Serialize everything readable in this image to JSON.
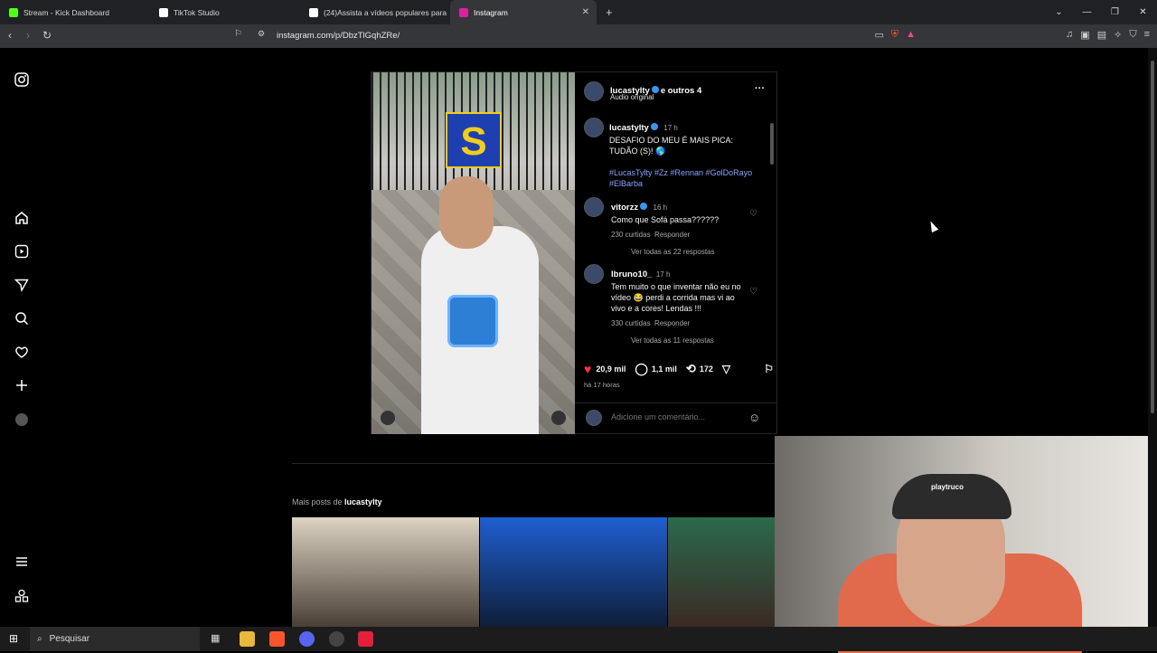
{
  "browser": {
    "tabs": [
      {
        "label": "Stream - Kick Dashboard",
        "color": "#53fc18"
      },
      {
        "label": "TikTok Studio",
        "color": "#ffffff"
      },
      {
        "label": "(24)Assista a vídeos populares para",
        "color": "#ffffff"
      },
      {
        "label": "Instagram",
        "color": "#d6249f",
        "active": true
      }
    ],
    "url": "instagram.com/p/DbzTlGqhZRe/"
  },
  "post": {
    "header": {
      "user": "lucastylty",
      "others": "e outros 4",
      "audio": "Áudio original",
      "menu": "···"
    },
    "caption": {
      "user": "lucastylty",
      "time": "17 h",
      "text": "DESAFIO DO MEU É MAIS PICA: TUDÃO (S)! 🌎",
      "tags": "#LucasTylty #Zz #Rennan #GolDoRayo #ElBarba"
    },
    "comments": [
      {
        "user": "vitorzz",
        "time": "16 h",
        "text": "Como que Sofá passa??????",
        "likes": "230 curtidas",
        "reply": "Responder",
        "view": "Ver todas as 22 respostas"
      },
      {
        "user": "lbruno10_",
        "time": "17 h",
        "text": "Tem muito o que inventar não eu no vídeo 😂 perdi a corrida mas vi ao vivo e a cores! Lendas !!!",
        "likes": "330 curtidas",
        "reply": "Responder",
        "view": "Ver todas as 11 respostas"
      }
    ],
    "actions": {
      "likes": "20,9 mil",
      "comments": "1,1 mil",
      "reposts": "172"
    },
    "age": "há 17 horas",
    "comment_placeholder": "Adicione um comentário..."
  },
  "more_posts": {
    "label": "Mais posts de",
    "user": "lucastylty"
  },
  "media": {
    "badge_letter": "S"
  },
  "webcam": {
    "cap_text": "playtruco"
  },
  "taskbar": {
    "search_placeholder": "Pesquisar"
  }
}
